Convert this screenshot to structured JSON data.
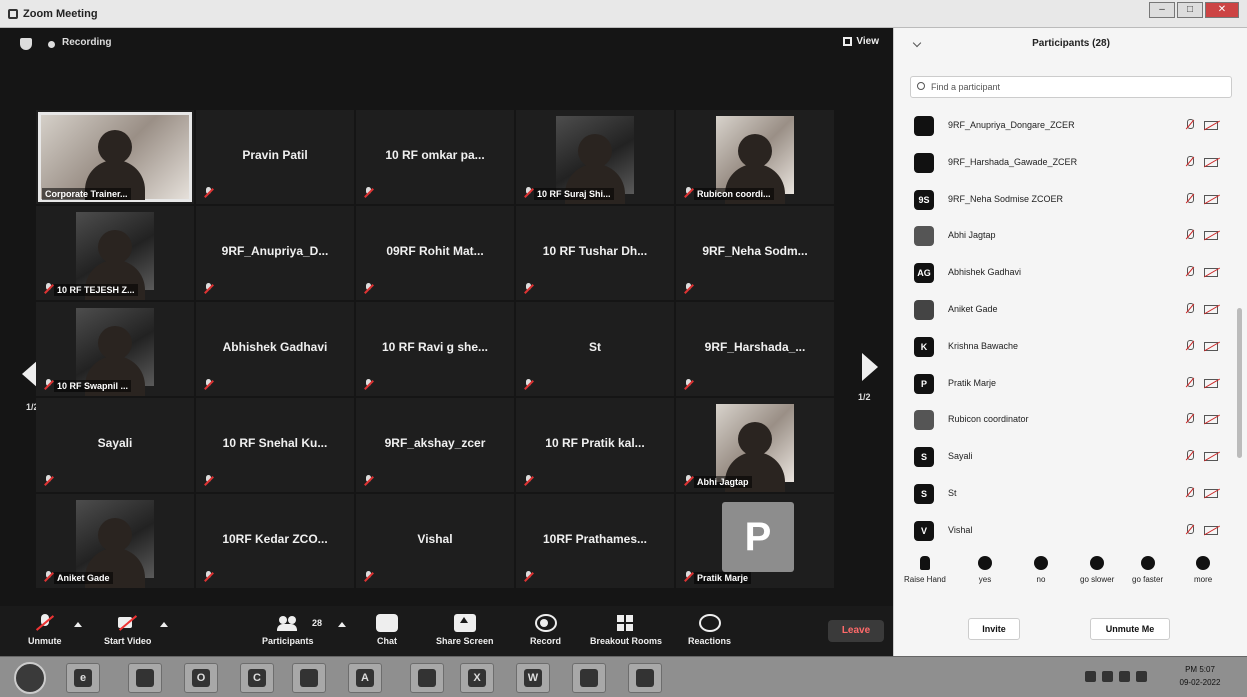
{
  "window": {
    "title": "Zoom Meeting",
    "min": "–",
    "max": "□",
    "close": "✕"
  },
  "topbar": {
    "recording": "Recording",
    "view": "View"
  },
  "tiles": [
    {
      "name": "Corporate Trainer..."
    },
    {
      "name": "Pravin Patil"
    },
    {
      "name": "10 RF omkar pa..."
    },
    {
      "name": "10 RF Suraj Shi..."
    },
    {
      "name": "Rubicon coordi..."
    },
    {
      "name": "10 RF TEJESH Z..."
    },
    {
      "name": "9RF_Anupriya_D..."
    },
    {
      "name": "09RF Rohit Mat..."
    },
    {
      "name": "10 RF Tushar Dh..."
    },
    {
      "name": "9RF_Neha Sodm..."
    },
    {
      "name": "10 RF Swapnil ..."
    },
    {
      "name": "Abhishek Gadhavi"
    },
    {
      "name": "10 RF Ravi g she..."
    },
    {
      "name": "St"
    },
    {
      "name": "9RF_Harshada_..."
    },
    {
      "name": "Sayali"
    },
    {
      "name": "10 RF Snehal Ku..."
    },
    {
      "name": "9RF_akshay_zcer"
    },
    {
      "name": "10 RF Pratik kal..."
    },
    {
      "name": "Abhi Jagtap"
    },
    {
      "name": "Aniket Gade"
    },
    {
      "name": "10RF Kedar ZCO..."
    },
    {
      "name": "Vishal"
    },
    {
      "name": "10RF Prathames..."
    },
    {
      "name": "Pratik Marje",
      "initial": "P"
    }
  ],
  "pager": {
    "left": "1/2",
    "right": "1/2"
  },
  "controls": {
    "unmute": "Unmute",
    "start_video": "Start Video",
    "participants": "Participants",
    "participants_count": "28",
    "chat": "Chat",
    "share": "Share Screen",
    "record": "Record",
    "breakout": "Breakout Rooms",
    "reactions": "Reactions",
    "leave": "Leave"
  },
  "panel": {
    "title": "Participants (28)",
    "search_placeholder": "Find a participant",
    "participants": [
      {
        "name": "9RF_Anupriya_Dongare_ZCER",
        "avatar": ""
      },
      {
        "name": "9RF_Harshada_Gawade_ZCER",
        "avatar": ""
      },
      {
        "name": "9RF_Neha Sodmise ZCOER",
        "avatar": "9S"
      },
      {
        "name": "Abhi Jagtap",
        "avatar": ""
      },
      {
        "name": "Abhishek Gadhavi",
        "avatar": "AG"
      },
      {
        "name": "Aniket Gade",
        "avatar": ""
      },
      {
        "name": "Krishna Bawache",
        "avatar": "K"
      },
      {
        "name": "Pratik Marje",
        "avatar": "P"
      },
      {
        "name": "Rubicon coordinator",
        "avatar": ""
      },
      {
        "name": "Sayali",
        "avatar": "S"
      },
      {
        "name": "St",
        "avatar": "S"
      },
      {
        "name": "Vishal",
        "avatar": "V"
      }
    ],
    "reactions": [
      "Raise Hand",
      "yes",
      "no",
      "go slower",
      "go faster",
      "more"
    ],
    "invite": "Invite",
    "unmute_me": "Unmute Me"
  },
  "taskbar": {
    "apps": [
      "e",
      "",
      "O",
      "C",
      "",
      "A",
      "",
      "X",
      "W",
      "",
      ""
    ],
    "time": "PM 5:07",
    "date": "09-02-2022"
  }
}
